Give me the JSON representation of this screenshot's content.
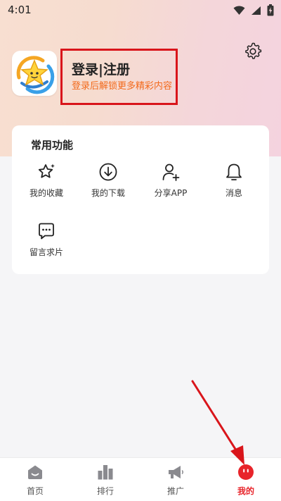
{
  "status_bar": {
    "time": "4:01",
    "icons": [
      "wifi-icon",
      "signal-icon",
      "battery-charging-icon"
    ]
  },
  "profile": {
    "avatar_icon": "star-logo-icon",
    "login_label": "登录|注册",
    "login_hint": "登录后解锁更多精彩内容",
    "settings_icon": "gear-icon"
  },
  "common_functions": {
    "title": "常用功能",
    "items": [
      {
        "label": "我的收藏",
        "icon": "star-sparkle-icon"
      },
      {
        "label": "我的下载",
        "icon": "download-icon"
      },
      {
        "label": "分享APP",
        "icon": "add-user-icon"
      },
      {
        "label": "消息",
        "icon": "bell-icon"
      },
      {
        "label": "留言求片",
        "icon": "message-icon"
      }
    ]
  },
  "tabbar": {
    "items": [
      {
        "label": "首页",
        "icon": "home-icon"
      },
      {
        "label": "排行",
        "icon": "bar-chart-icon"
      },
      {
        "label": "推广",
        "icon": "megaphone-icon"
      },
      {
        "label": "我的",
        "icon": "profile-face-icon",
        "active": true
      }
    ]
  },
  "colors": {
    "accent": "#e8242a",
    "hint": "#f36a1c",
    "annotation": "#d9151b"
  }
}
